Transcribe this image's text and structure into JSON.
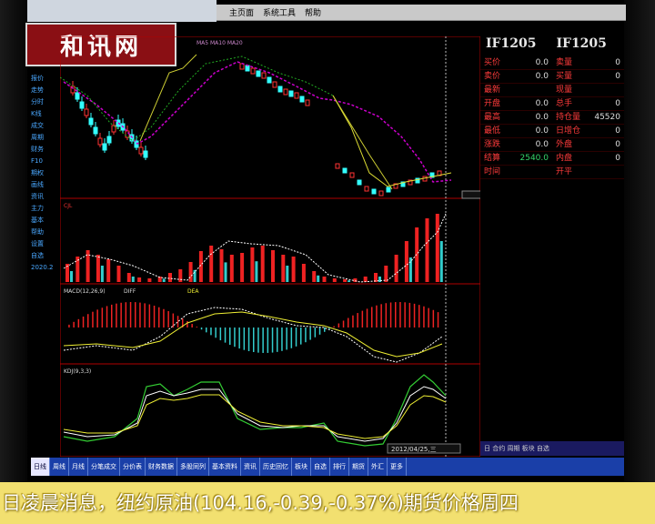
{
  "watermark": "和讯网",
  "menu": [
    "主页面",
    "系统工具",
    "帮助"
  ],
  "left_nav": [
    "报价",
    "走势",
    "分时",
    "K线",
    "成交",
    "周期",
    "财务",
    "F10",
    "期权",
    "画线",
    "资讯",
    "主力",
    "基本",
    "帮助",
    "设置",
    "自选",
    "2020.2"
  ],
  "chart": {
    "date_label": "2012/04/25,三",
    "indicator_labels": [
      "CJL",
      "MACD(12,26,9)",
      "DIFF",
      "DEA",
      "KDJ(9,3,3)"
    ],
    "ma_label": "MA5 MA10 MA20"
  },
  "info_panel": {
    "code_a": "IF1205",
    "code_b": "IF1205",
    "rows": [
      {
        "l1": "买价",
        "v1": "0.0",
        "l2": "卖量",
        "v2": "0"
      },
      {
        "l1": "卖价",
        "v1": "0.0",
        "l2": "买量",
        "v2": "0"
      },
      {
        "l1": "最新",
        "v1": "",
        "l2": "现量",
        "v2": ""
      },
      {
        "l1": "开盘",
        "v1": "0.0",
        "l2": "总手",
        "v2": "0"
      },
      {
        "l1": "最高",
        "v1": "0.0",
        "l2": "持仓量",
        "v2": "45520"
      },
      {
        "l1": "最低",
        "v1": "0.0",
        "l2": "日增仓",
        "v2": "0"
      },
      {
        "l1": "涨跌",
        "v1": "0.0",
        "l2": "外盘",
        "v2": "0"
      },
      {
        "l1": "结算",
        "v1": "2540.0",
        "l2": "内盘",
        "v2": "0"
      },
      {
        "l1": "时间",
        "v1": "",
        "l2": "开平",
        "v2": ""
      }
    ]
  },
  "tabs": [
    "日线",
    "周线",
    "月线",
    "分笔成交",
    "分价表",
    "财务数据",
    "多股同列",
    "基本资料",
    "资讯",
    "历史回忆",
    "板块",
    "自选",
    "排行",
    "期货",
    "外汇",
    "更多"
  ],
  "right_mini": "日 合约 周期 板块 自选",
  "ticker": "日凌晨消息，纽约原油(104.16,-0.39,-0.37%)期货价格周四"
}
